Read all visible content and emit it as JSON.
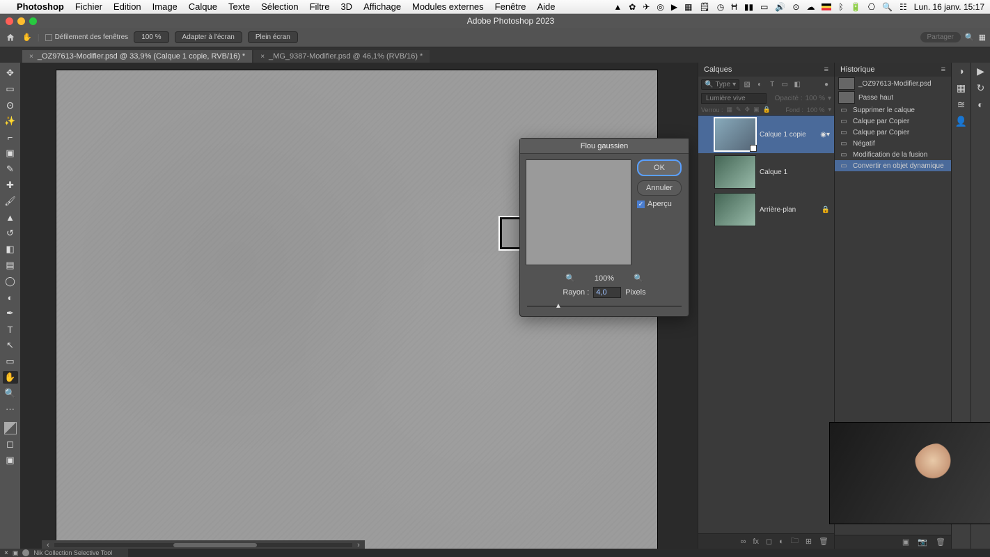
{
  "menubar": {
    "app": "Photoshop",
    "items": [
      "Fichier",
      "Edition",
      "Image",
      "Calque",
      "Texte",
      "Sélection",
      "Filtre",
      "3D",
      "Affichage",
      "Modules externes",
      "Fenêtre",
      "Aide"
    ],
    "clock": "Lun. 16 janv.  15:17"
  },
  "window": {
    "title": "Adobe Photoshop 2023"
  },
  "options": {
    "scroll_label": "Défilement des fenêtres",
    "zoom": "100 %",
    "fit": "Adapter à l'écran",
    "full": "Plein écran",
    "share": "Partager"
  },
  "tabs": [
    {
      "label": "_OZ97613-Modifier.psd @ 33,9% (Calque 1 copie, RVB/16) *",
      "active": true
    },
    {
      "label": "_MG_9387-Modifier.psd @ 46,1% (RVB/16) *",
      "active": false
    }
  ],
  "dialog": {
    "title": "Flou gaussien",
    "ok": "OK",
    "cancel": "Annuler",
    "preview": "Aperçu",
    "zoom": "100%",
    "radius_label": "Rayon :",
    "radius_value": "4,0",
    "radius_unit": "Pixels"
  },
  "layers": {
    "title": "Calques",
    "filter_type": "Type",
    "blend_mode": "Lumière vive",
    "opacity_label": "Opacité :",
    "opacity_value": "100 %",
    "lock_label": "Verrou :",
    "fill_label": "Fond :",
    "fill_value": "100 %",
    "items": [
      {
        "name": "Calque 1 copie",
        "selected": true,
        "smart": true
      },
      {
        "name": "Calque 1",
        "selected": false
      },
      {
        "name": "Arrière-plan",
        "selected": false,
        "locked": true
      }
    ]
  },
  "history": {
    "title": "Historique",
    "snapshots": [
      "_OZ97613-Modifier.psd",
      "Passe haut"
    ],
    "steps": [
      "Supprimer le calque",
      "Calque par Copier",
      "Calque par Copier",
      "Négatif",
      "Modification de la fusion",
      "Convertir en objet dynamique"
    ]
  },
  "status": {
    "tool": "Nik Collection Selective Tool"
  }
}
